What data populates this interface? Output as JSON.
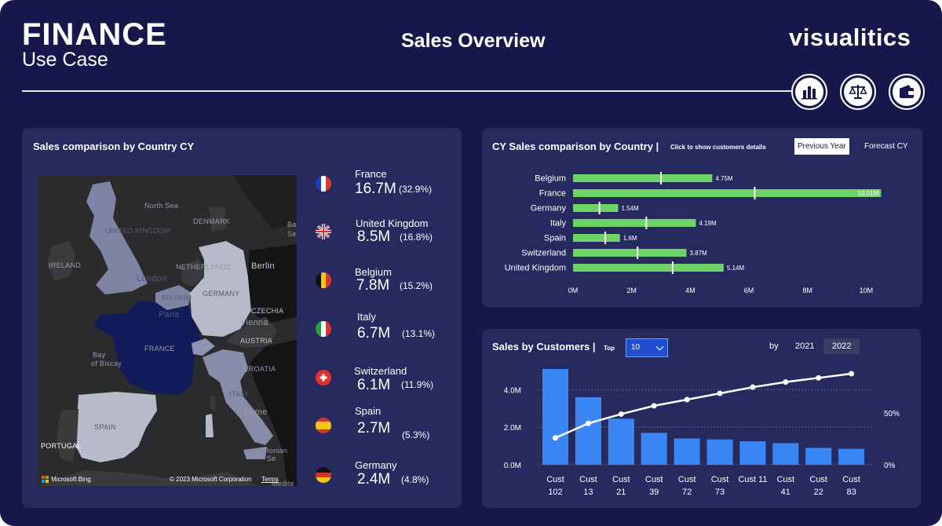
{
  "header": {
    "brand_title": "FINANCE",
    "brand_subtitle": "Use Case",
    "page_title": "Sales Overview",
    "logo_text": "visualitics",
    "nav_icons": [
      "bar-chart-icon",
      "scales-icon",
      "wallet-icon"
    ]
  },
  "map_card": {
    "title": "Sales comparison by Country CY",
    "map_labels": {
      "north_sea": "North Sea",
      "united_kingdom": "UNITED KINGDOM",
      "denmark": "DENMARK",
      "ireland": "IRELAND",
      "netherlands": "NETHERLANDS",
      "london": "London",
      "berlin": "Berlin",
      "belgium": "BELGIUM",
      "germany": "GERMANY",
      "paris": "Paris",
      "czechia": "CZECHIA",
      "vienna": "Vienna",
      "austria": "AUSTRIA",
      "france": "FRANCE",
      "croatia": "CROATIA",
      "bay": "Bay",
      "of_biscay": "of Biscay",
      "italy": "ITALY",
      "rome": "Rome",
      "spain": "SPAIN",
      "portugal": "PORTUGAL",
      "ionian": "Ionian Se",
      "medite": "Medite",
      "bal": "Bal",
      "se": "Se"
    },
    "attribution": {
      "bing": "Microsoft Bing",
      "copyright": "© 2023 Microsoft Corporation",
      "terms": "Terms"
    },
    "countries": [
      {
        "name": "France",
        "value": "16.7M",
        "pct": "(32.9%)",
        "flag": "france-flag-icon"
      },
      {
        "name": "United Kingdom",
        "value": "8.5M",
        "pct": "(16.8%)",
        "flag": "uk-flag-icon"
      },
      {
        "name": "Belgium",
        "value": "7.8M",
        "pct": "(15.2%)",
        "flag": "belgium-flag-icon"
      },
      {
        "name": "Italy",
        "value": "6.7M",
        "pct": "(13.1%)",
        "flag": "italy-flag-icon"
      },
      {
        "name": "Switzerland",
        "value": "6.1M",
        "pct": "(11.9%)",
        "flag": "switzerland-flag-icon"
      },
      {
        "name": "Spain",
        "value": "2.7M",
        "pct": "(5.3%)",
        "flag": "spain-flag-icon"
      },
      {
        "name": "Germany",
        "value": "2.4M",
        "pct": "(4.8%)",
        "flag": "germany-flag-icon"
      }
    ]
  },
  "cy_card": {
    "title": "CY Sales comparison by Country |",
    "hint": "Click to show customers details",
    "toggles": {
      "previous_year": "Previous Year",
      "forecast": "Forecast CY"
    }
  },
  "cust_card": {
    "title": "Sales by Customers |",
    "top_label": "Top",
    "top_value": "10",
    "by_label": "by",
    "years": [
      "2021",
      "2022"
    ],
    "active_year": "2022"
  },
  "chart_data": [
    {
      "type": "bar",
      "orientation": "horizontal",
      "categories": [
        "Belgium",
        "France",
        "Germany",
        "Italy",
        "Spain",
        "Switzerland",
        "United Kingdom"
      ],
      "values": [
        4.75,
        10.51,
        1.54,
        4.19,
        1.6,
        3.87,
        5.14
      ],
      "value_labels": [
        "4.75M",
        "10.51M",
        "1.54M",
        "4.19M",
        "1.6M",
        "3.87M",
        "5.14M"
      ],
      "marker_values": [
        3.0,
        6.2,
        0.9,
        2.5,
        1.1,
        2.2,
        3.4
      ],
      "xlim": [
        0,
        10.5
      ],
      "xticks": [
        "0M",
        "2M",
        "4M",
        "6M",
        "8M",
        "10M"
      ],
      "xtick_values": [
        0,
        2,
        4,
        6,
        8,
        10
      ],
      "bar_color": "#6fd36a",
      "marker_color": "#ffffff"
    },
    {
      "type": "bar",
      "categories": [
        [
          "Cust",
          "102"
        ],
        [
          "Cust",
          "13"
        ],
        [
          "Cust",
          "21"
        ],
        [
          "Cust",
          "39"
        ],
        [
          "Cust",
          "72"
        ],
        [
          "Cust",
          "73"
        ],
        [
          "Cust 11",
          ""
        ],
        [
          "Cust",
          "41"
        ],
        [
          "Cust",
          "22"
        ],
        [
          "Cust",
          "83"
        ]
      ],
      "values": [
        5.1,
        3.6,
        2.45,
        1.7,
        1.4,
        1.35,
        1.25,
        1.15,
        0.9,
        0.85
      ],
      "ylim": [
        0,
        5.1
      ],
      "yticks": [
        "0.0M",
        "2.0M",
        "4.0M"
      ],
      "ytick_values": [
        0,
        2,
        4
      ],
      "line_values": [
        26,
        40,
        49,
        57,
        63,
        69,
        75,
        80,
        84,
        88
      ],
      "y2lim": [
        0,
        100
      ],
      "y2ticks": [
        "0%",
        "50%"
      ],
      "y2tick_values": [
        0,
        50
      ],
      "bar_color": "#3a86f5",
      "line_color": "#ffffff"
    }
  ]
}
